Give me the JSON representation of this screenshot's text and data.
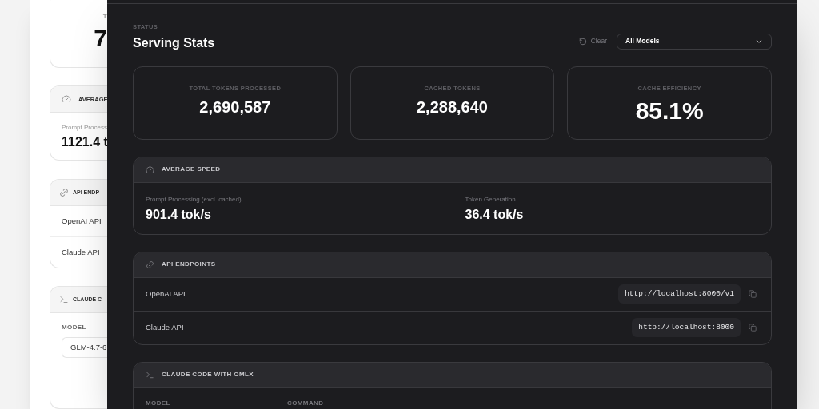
{
  "back_window": {
    "stat_label": "T",
    "stat_value": "7",
    "speed": {
      "title": "AVERAGE",
      "label": "Prompt Process",
      "value": "1121.4 t"
    },
    "endpoints": {
      "title": "API ENDP",
      "rows": [
        "OpenAI API",
        "Claude API"
      ]
    },
    "claude_code": {
      "title": "CLAUDE C",
      "model_label": "MODEL",
      "model_value": "GLM-4.7-6"
    }
  },
  "front_window": {
    "eyebrow": "STATUS",
    "title": "Serving Stats",
    "clear_label": "Clear",
    "model_filter": "All Models",
    "stats": [
      {
        "label": "TOTAL TOKENS PROCESSED",
        "value": "2,690,587"
      },
      {
        "label": "CACHED TOKENS",
        "value": "2,288,640"
      },
      {
        "label": "CACHE EFFICIENCY",
        "value": "85.1%"
      }
    ],
    "speed": {
      "title": "AVERAGE SPEED",
      "items": [
        {
          "label": "Prompt Processing",
          "note": "(excl. cached)",
          "value": "901.4 tok/s"
        },
        {
          "label": "Token Generation",
          "value": "36.4 tok/s"
        }
      ]
    },
    "endpoints": {
      "title": "API ENDPOINTS",
      "rows": [
        {
          "name": "OpenAI API",
          "url": "http://localhost:8000/v1"
        },
        {
          "name": "Claude API",
          "url": "http://localhost:8000"
        }
      ]
    },
    "claude_code": {
      "title": "CLAUDE CODE WITH OMLX",
      "columns": [
        "MODEL",
        "COMMAND"
      ]
    }
  }
}
